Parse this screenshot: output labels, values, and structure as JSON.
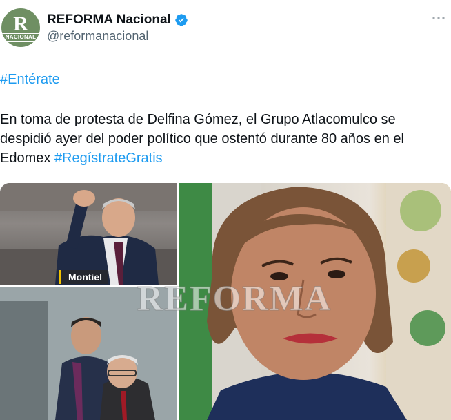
{
  "account": {
    "avatar_letter": "R",
    "avatar_subtext": "NACIONAL",
    "name": "REFORMA Nacional",
    "handle": "@reformanacional",
    "avatar_color": "#6f8f63",
    "verified_color": "#1d9bf0"
  },
  "tweet": {
    "hashtag": "#Entérate",
    "text": "En toma de protesta de Delfina Gómez, el Grupo Atlacomulco se despidió ayer del poder político que ostentó durante 80 años en el Edomex ",
    "link_hashtag": "#RegístrateGratis"
  },
  "media": {
    "caption": "Montiel",
    "watermark": "REFORMA"
  },
  "colors": {
    "link": "#1d9bf0",
    "text": "#0f1419",
    "secondary": "#536471"
  },
  "icons": {
    "verified": "verified-badge-icon",
    "more": "more-options-icon"
  }
}
